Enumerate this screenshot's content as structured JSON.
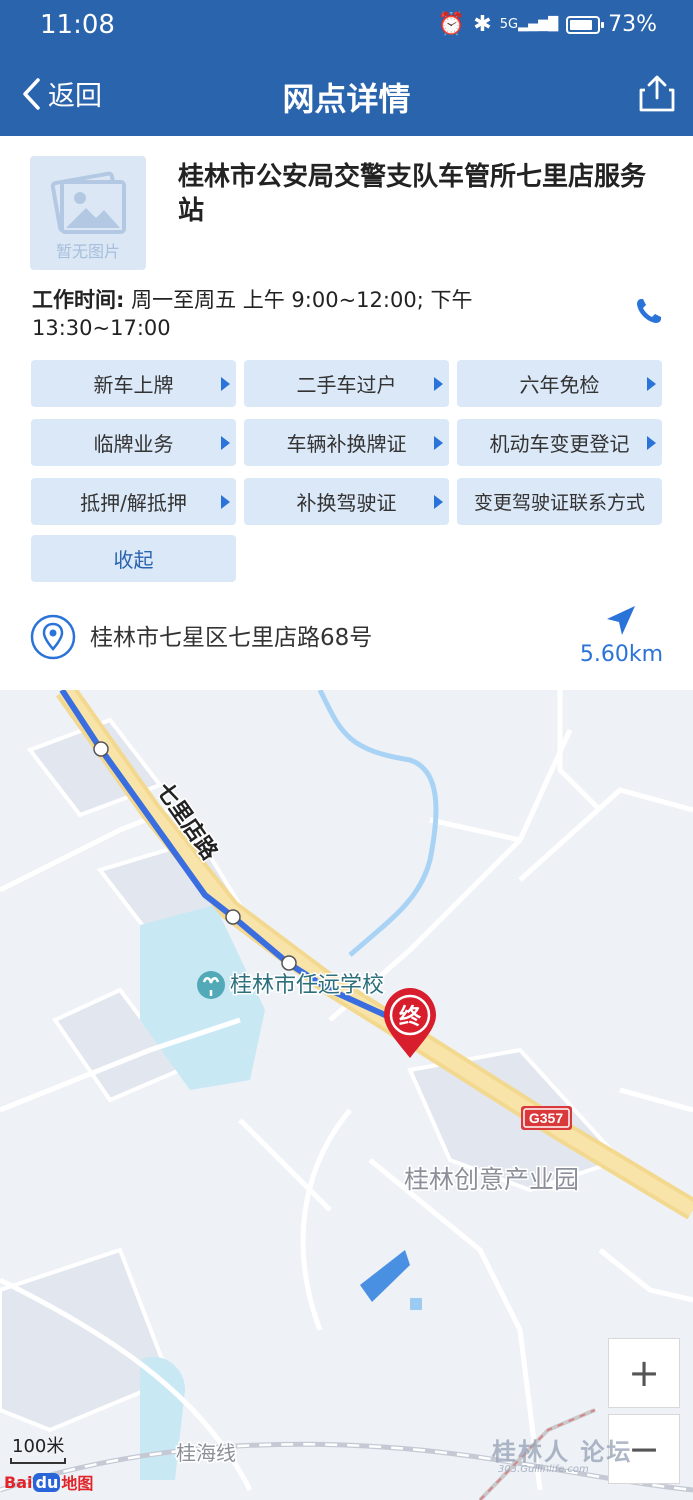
{
  "status_bar": {
    "time": "11:08",
    "signal": "5G",
    "battery": "73%"
  },
  "nav": {
    "back_label": "返回",
    "title": "网点详情"
  },
  "station": {
    "no_image_label": "暂无图片",
    "name": "桂林市公安局交警支队车管所七里店服务站",
    "hours_label": "工作时间:",
    "hours_value": " 周一至周五 上午 9:00~12:00; 下午 13:30~17:00"
  },
  "services": [
    "新车上牌",
    "二手车过户",
    "六年免检",
    "临牌业务",
    "车辆补换牌证",
    "机动车变更登记",
    "抵押/解抵押",
    "补换驾驶证",
    "变更驾驶证联系方式"
  ],
  "collapse_label": "收起",
  "address": {
    "text": "桂林市七星区七里店路68号",
    "distance": "5.60km"
  },
  "map": {
    "road_label": "七里店路",
    "school_label": "桂林市任远学校",
    "park_label": "桂林创意产业园",
    "highway_badge": "G357",
    "rail_label": "桂海线",
    "end_marker": "终",
    "scale_label": "100米",
    "logo_bai": "Bai",
    "logo_du": "du",
    "logo_map": "地图",
    "watermark": "桂林人 论坛",
    "watermark_url": "303.Guilinlife.com",
    "zoom_in": "+",
    "zoom_out": "−"
  },
  "colors": {
    "header_blue": "#2a64ad",
    "button_bg": "#dbe8f8",
    "accent_blue": "#2a73d9",
    "marker_red": "#d81e2c",
    "route_blue": "#3a6ee0"
  }
}
